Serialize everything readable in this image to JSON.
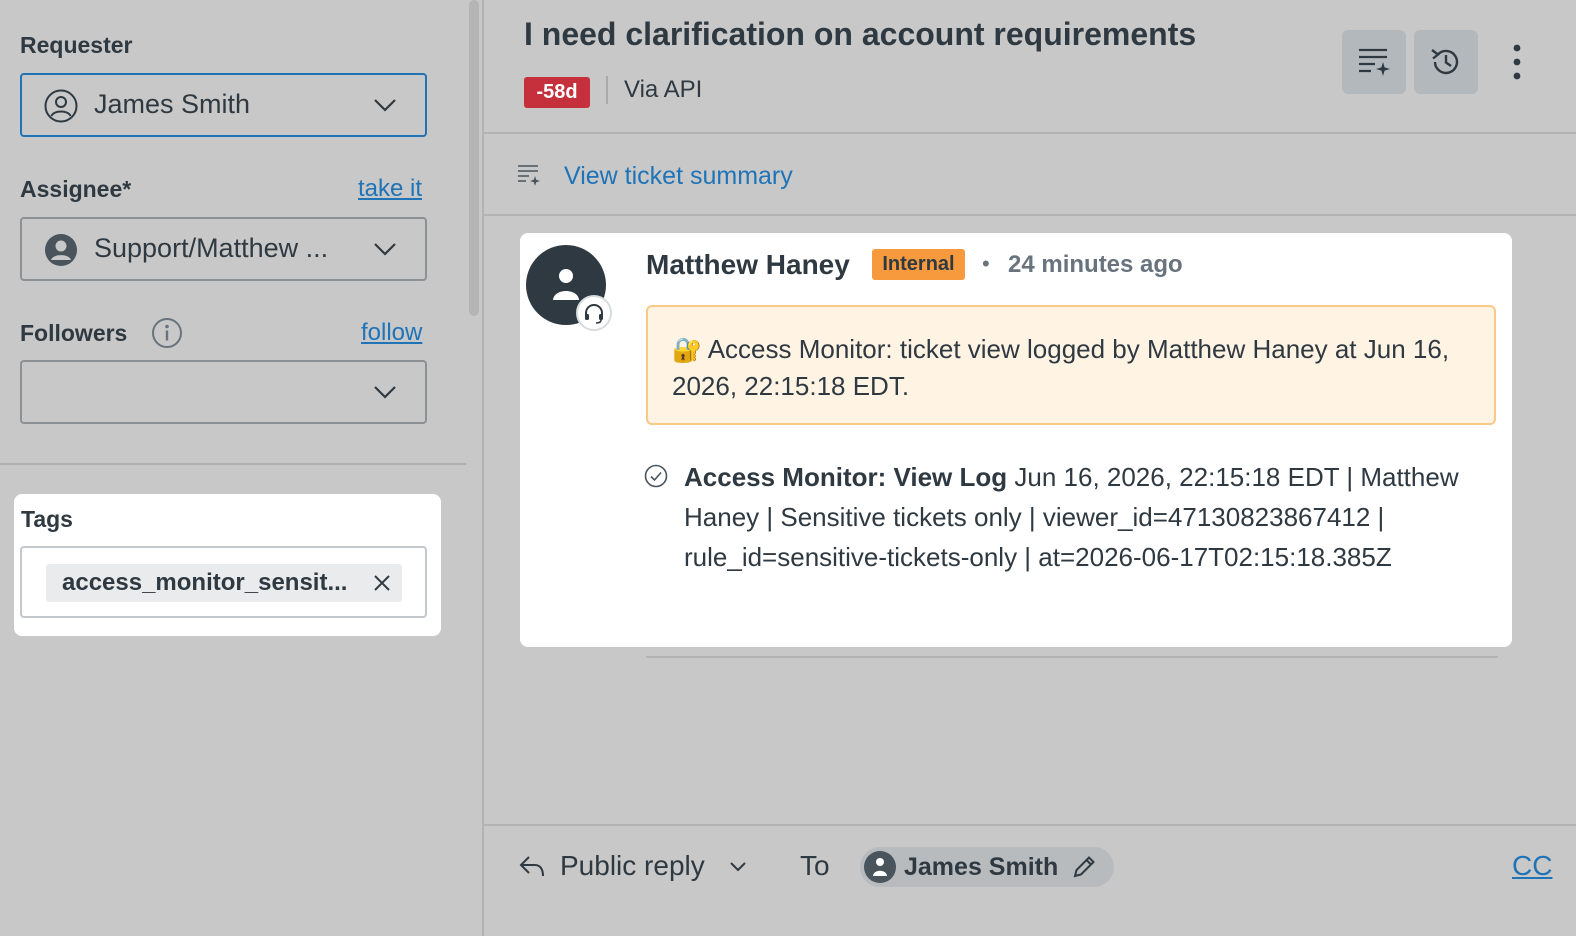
{
  "sidebar": {
    "requester": {
      "label": "Requester",
      "value": "James Smith",
      "icon": "user-circle-icon"
    },
    "assignee": {
      "label": "Assignee*",
      "action_link": "take it",
      "value": "Support/Matthew ...",
      "icon": "user-avatar-icon"
    },
    "followers": {
      "label": "Followers",
      "info_icon": "info-icon",
      "action_link": "follow",
      "value": ""
    },
    "tags": {
      "label": "Tags",
      "items": [
        "access_monitor_sensit..."
      ]
    }
  },
  "ticket": {
    "title": "I need clarification on account requirements",
    "age_badge": "-58d",
    "channel": "Via API",
    "summary_link": "View ticket summary"
  },
  "comment": {
    "author": "Matthew Haney",
    "visibility_badge": "Internal",
    "separator": "•",
    "time": "24 minutes ago",
    "notice_icon": "🔐",
    "notice_text": "Access Monitor: ticket view logged by Matthew Haney at Jun 16, 2026, 22:15:18 EDT.",
    "log_title": "Access Monitor: View Log",
    "log_body": "Jun 16, 2026, 22:15:18 EDT | Matthew Haney | Sensitive tickets only | viewer_id=47130823867412 | rule_id=sensitive-tickets-only | at=2026-06-17T02:15:18.385Z"
  },
  "reply": {
    "type": "Public reply",
    "to_label": "To",
    "recipient": "James Smith",
    "cc_label": "CC"
  },
  "colors": {
    "link": "#1f73b7",
    "age_badge": "#c62f3c",
    "internal_badge": "#f79a3e",
    "notice_bg": "#fff3e4",
    "notice_border": "#f8c987"
  }
}
